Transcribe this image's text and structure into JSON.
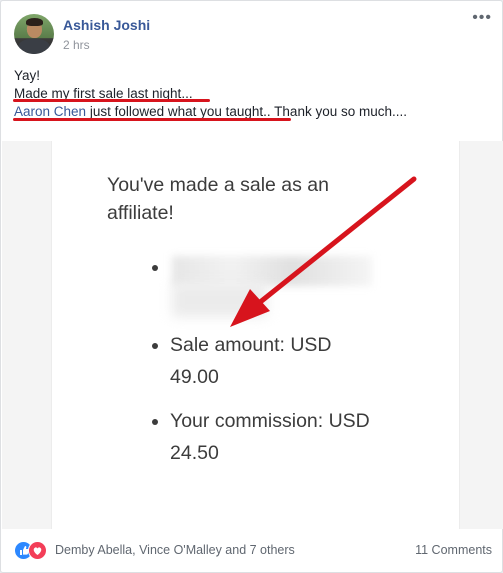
{
  "post": {
    "author": "Ashish Joshi",
    "time": "2 hrs",
    "more_label": "•••",
    "text": {
      "line1": "Yay!",
      "line2": "Made my first sale last night...",
      "mention": "Aaron Chen",
      "line3_rest": " just followed what you taught.. Thank you so much...."
    }
  },
  "image": {
    "heading": "You've made a sale as an affiliate!",
    "bullet1_obscured": "Det...",
    "bullet2": "Sale amount: USD 49.00",
    "bullet2_line1": "Sale amount: USD",
    "bullet2_line2": "49.00",
    "bullet3_line1": "Your commission: USD",
    "bullet3_line2": "24.50",
    "annotation_color": "#d7141d"
  },
  "footer": {
    "reactions": [
      "like-icon",
      "love-icon"
    ],
    "reactors": "Demby Abella, Vince O'Malley and 7 others",
    "comments": "11 Comments"
  },
  "colors": {
    "link": "#385898",
    "muted": "#90949c",
    "like": "#2d88ff",
    "love": "#f33e58",
    "underline": "#d7141d"
  }
}
